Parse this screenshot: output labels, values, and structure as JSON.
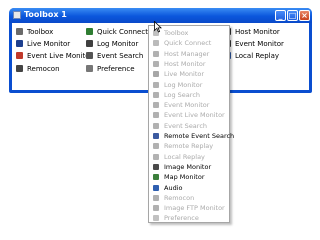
{
  "window": {
    "title": "Toolbox 1",
    "controls": [
      "_",
      "□",
      "×"
    ]
  },
  "items": [
    {
      "label": "Toolbox",
      "icon": "toolbox-icon",
      "color": "#6a6a6a"
    },
    {
      "label": "Quick Connect",
      "icon": "quick-connect-icon",
      "color": "#2f7d32"
    },
    {
      "label": "Host Monitor",
      "icon": "host-monitor-icon",
      "color": "#333333"
    },
    {
      "label": "Live Monitor",
      "icon": "live-monitor-icon",
      "color": "#1d3f8f"
    },
    {
      "label": "Log Monitor",
      "icon": "log-monitor-icon",
      "color": "#404040"
    },
    {
      "label": "Event Monitor",
      "icon": "event-monitor-icon",
      "color": "#3a3a3a"
    },
    {
      "label": "Event Live Monitor",
      "icon": "event-live-monitor-icon",
      "color": "#c0392b"
    },
    {
      "label": "Event Search",
      "icon": "event-search-icon",
      "color": "#555555"
    },
    {
      "label": "Local Replay",
      "icon": "local-replay-icon",
      "color": "#2e5aa8"
    },
    {
      "label": "Remocon",
      "icon": "remocon-icon",
      "color": "#444444"
    },
    {
      "label": "Preference",
      "icon": "preference-icon",
      "color": "#777777"
    }
  ],
  "menu": [
    {
      "label": "Toolbox",
      "enabled": false,
      "icon": "toolbox-icon",
      "color": "#777777"
    },
    {
      "label": "Quick Connect",
      "enabled": false,
      "icon": "quick-connect-icon",
      "color": "#2f7d32"
    },
    {
      "label": "Host Manager",
      "enabled": false,
      "icon": "host-manager-icon",
      "color": "#555555"
    },
    {
      "label": "Host Monitor",
      "enabled": false,
      "icon": "host-monitor-icon",
      "color": "#555555"
    },
    {
      "label": "Live Monitor",
      "enabled": false,
      "icon": "live-monitor-icon",
      "color": "#1d3f8f"
    },
    {
      "label": "Log Monitor",
      "enabled": false,
      "icon": "log-monitor-icon",
      "color": "#555555"
    },
    {
      "label": "Log Search",
      "enabled": false,
      "icon": "log-search-icon",
      "color": "#555555"
    },
    {
      "label": "Event Monitor",
      "enabled": false,
      "icon": "event-monitor-icon",
      "color": "#555555"
    },
    {
      "label": "Event Live Monitor",
      "enabled": false,
      "icon": "event-live-monitor-icon",
      "color": "#c0392b"
    },
    {
      "label": "Event Search",
      "enabled": false,
      "icon": "event-search-icon",
      "color": "#555555"
    },
    {
      "label": "Remote Event Search",
      "enabled": true,
      "icon": "remote-event-search-icon",
      "color": "#3c5aa0"
    },
    {
      "label": "Remote Replay",
      "enabled": false,
      "icon": "remote-replay-icon",
      "color": "#555555"
    },
    {
      "label": "Local Replay",
      "enabled": false,
      "icon": "local-replay-icon",
      "color": "#2e5aa8"
    },
    {
      "label": "Image Monitor",
      "enabled": true,
      "icon": "image-monitor-icon",
      "color": "#4a4a4a"
    },
    {
      "label": "Map Monitor",
      "enabled": true,
      "icon": "map-monitor-icon",
      "color": "#3b7f3b"
    },
    {
      "label": "Audio",
      "enabled": true,
      "icon": "audio-icon",
      "color": "#2f5fb0"
    },
    {
      "label": "Remocon",
      "enabled": false,
      "icon": "remocon-icon",
      "color": "#555555"
    },
    {
      "label": "Image FTP Monitor",
      "enabled": false,
      "icon": "image-ftp-monitor-icon",
      "color": "#555555"
    },
    {
      "label": "Preference",
      "enabled": false,
      "icon": "preference-icon",
      "color": "#777777"
    }
  ]
}
